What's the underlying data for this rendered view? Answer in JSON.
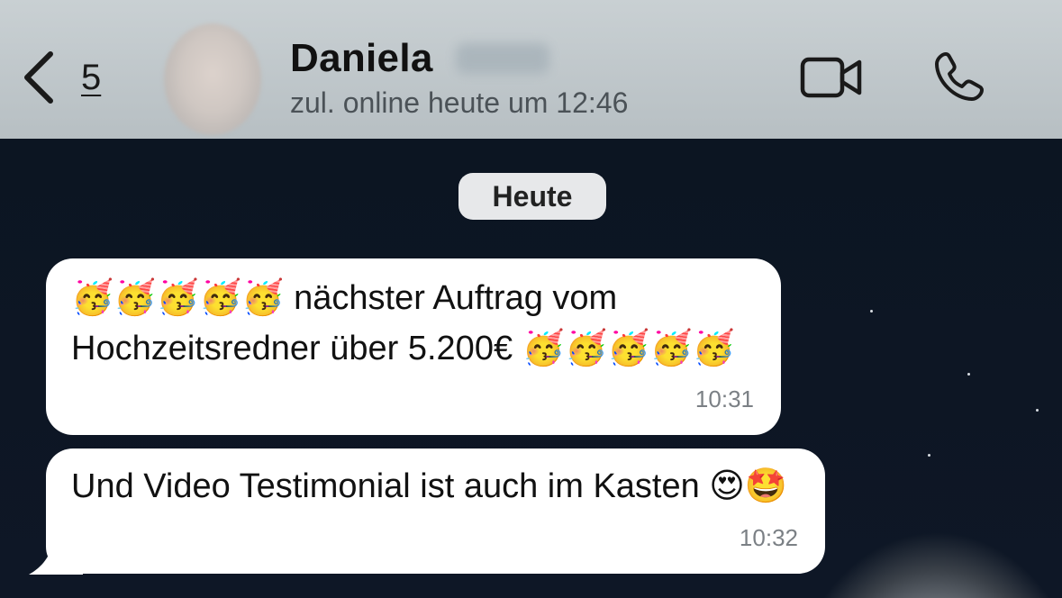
{
  "header": {
    "back_count": "5",
    "contact_name": "Daniela",
    "status": "zul. online heute um 12:46"
  },
  "chat": {
    "date_divider": "Heute",
    "messages": [
      {
        "text": "🥳🥳🥳🥳🥳 nächster Auftrag vom Hochzeitsredner über 5.200€ 🥳🥳🥳🥳🥳",
        "time": "10:31"
      },
      {
        "text": "Und Video Testimonial ist auch im Kasten 😍🤩",
        "time": "10:32"
      }
    ]
  },
  "icons": [
    "back-chevron-icon",
    "video-camera-icon",
    "phone-icon"
  ],
  "colors": {
    "header_bg": "#c3cacd",
    "bubble_bg": "#ffffff",
    "chat_bg": "#0d1420",
    "date_pill_bg": "#e7e8ea"
  }
}
